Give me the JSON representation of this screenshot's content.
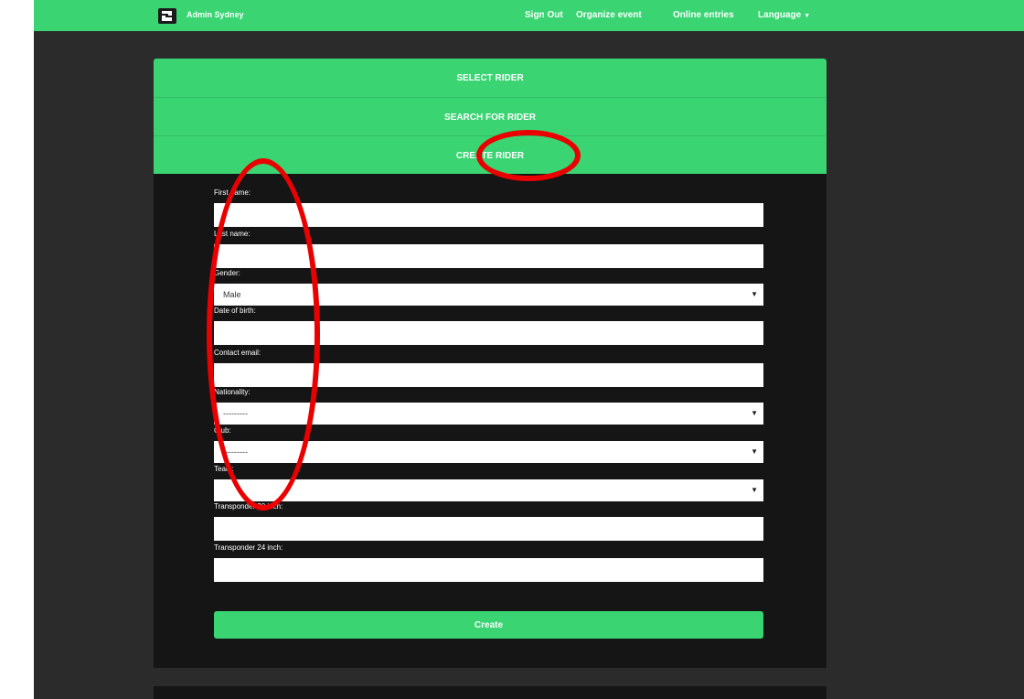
{
  "navbar": {
    "brand": "Admin Sydney",
    "links": [
      "Sign Out",
      "Organize event",
      "Online entries",
      "Language"
    ]
  },
  "accordion": {
    "select_rider": "SELECT RIDER",
    "search_rider": "SEARCH FOR RIDER",
    "create_rider": "CREATE RIDER"
  },
  "form": {
    "first_name_label": "First name:",
    "last_name_label": "Last name:",
    "gender_label": "Gender:",
    "gender_value": "Male",
    "dob_label": "Date of birth:",
    "email_label": "Contact email:",
    "nationality_label": "Nationality:",
    "nationality_value": "---------",
    "club_label": "Club:",
    "club_value": "---------",
    "team_label": "Team:",
    "team_value": "",
    "transponder20_label": "Transponder 20 inch:",
    "transponder24_label": "Transponder 24 inch:",
    "create_label": "Create"
  },
  "colors": {
    "brand_green": "#3ad473",
    "annotation_red": "#ea0000",
    "panel_dark": "#151515",
    "page_bg": "#2b2b2b"
  },
  "icons": {
    "logo": "brand-logo-icon",
    "dropdown": "caret-down-icon"
  }
}
